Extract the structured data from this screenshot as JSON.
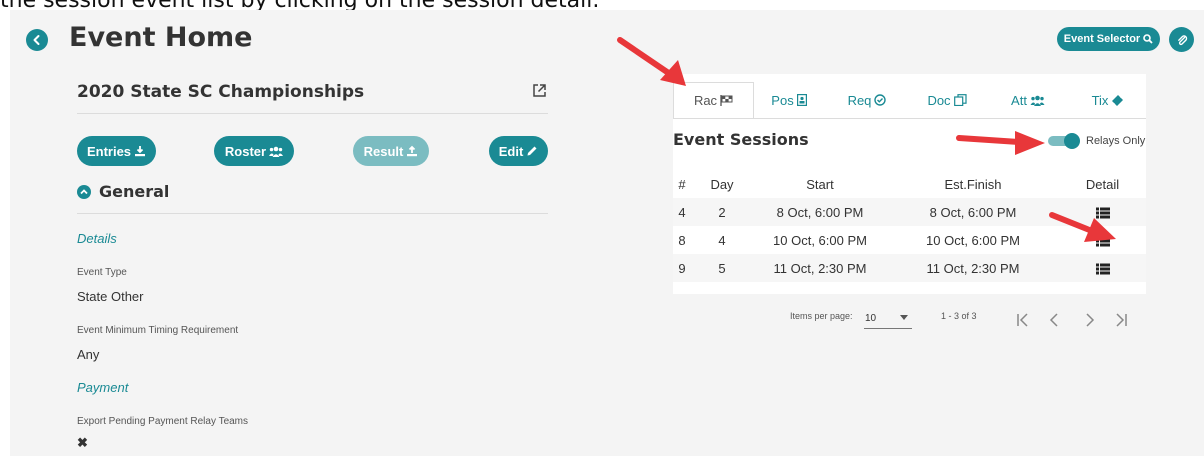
{
  "caption": "the session event list by clicking on the session detail.",
  "header": {
    "title": "Event Home",
    "selector_label": "Event Selector"
  },
  "event": {
    "name": "2020 State SC Championships"
  },
  "actions": {
    "entries": "Entries",
    "roster": "Roster",
    "result": "Result",
    "edit": "Edit"
  },
  "general": {
    "title": "General",
    "details_head": "Details",
    "event_type_label": "Event Type",
    "event_type_value": "State Other",
    "timing_label": "Event Minimum Timing Requirement",
    "timing_value": "Any",
    "payment_head": "Payment",
    "export_label": "Export Pending Payment Relay Teams",
    "export_value": "✖"
  },
  "tabs": [
    {
      "label": "Rac",
      "icon": "flag-icon",
      "active": true
    },
    {
      "label": "Pos",
      "icon": "badge-icon",
      "active": false
    },
    {
      "label": "Req",
      "icon": "check-circle-icon",
      "active": false
    },
    {
      "label": "Doc",
      "icon": "documents-icon",
      "active": false
    },
    {
      "label": "Att",
      "icon": "users-icon",
      "active": false
    },
    {
      "label": "Tix",
      "icon": "ticket-icon",
      "active": false
    }
  ],
  "sessions": {
    "title": "Event Sessions",
    "relays_only_label": "Relays Only",
    "relays_only_on": true,
    "columns": [
      "#",
      "Day",
      "Start",
      "Est.Finish",
      "Detail"
    ],
    "rows": [
      {
        "num": "4",
        "day": "2",
        "start": "8 Oct, 6:00 PM",
        "finish": "8 Oct, 6:00 PM"
      },
      {
        "num": "8",
        "day": "4",
        "start": "10 Oct, 6:00 PM",
        "finish": "10 Oct, 6:00 PM"
      },
      {
        "num": "9",
        "day": "5",
        "start": "11 Oct, 2:30 PM",
        "finish": "11 Oct, 2:30 PM"
      }
    ]
  },
  "pager": {
    "items_label": "Items per page:",
    "page_size": "10",
    "range": "1 - 3 of 3"
  },
  "colors": {
    "accent": "#1a8a94",
    "accent_disabled": "#7bbcc1",
    "annotation_arrow": "#e8373a"
  }
}
